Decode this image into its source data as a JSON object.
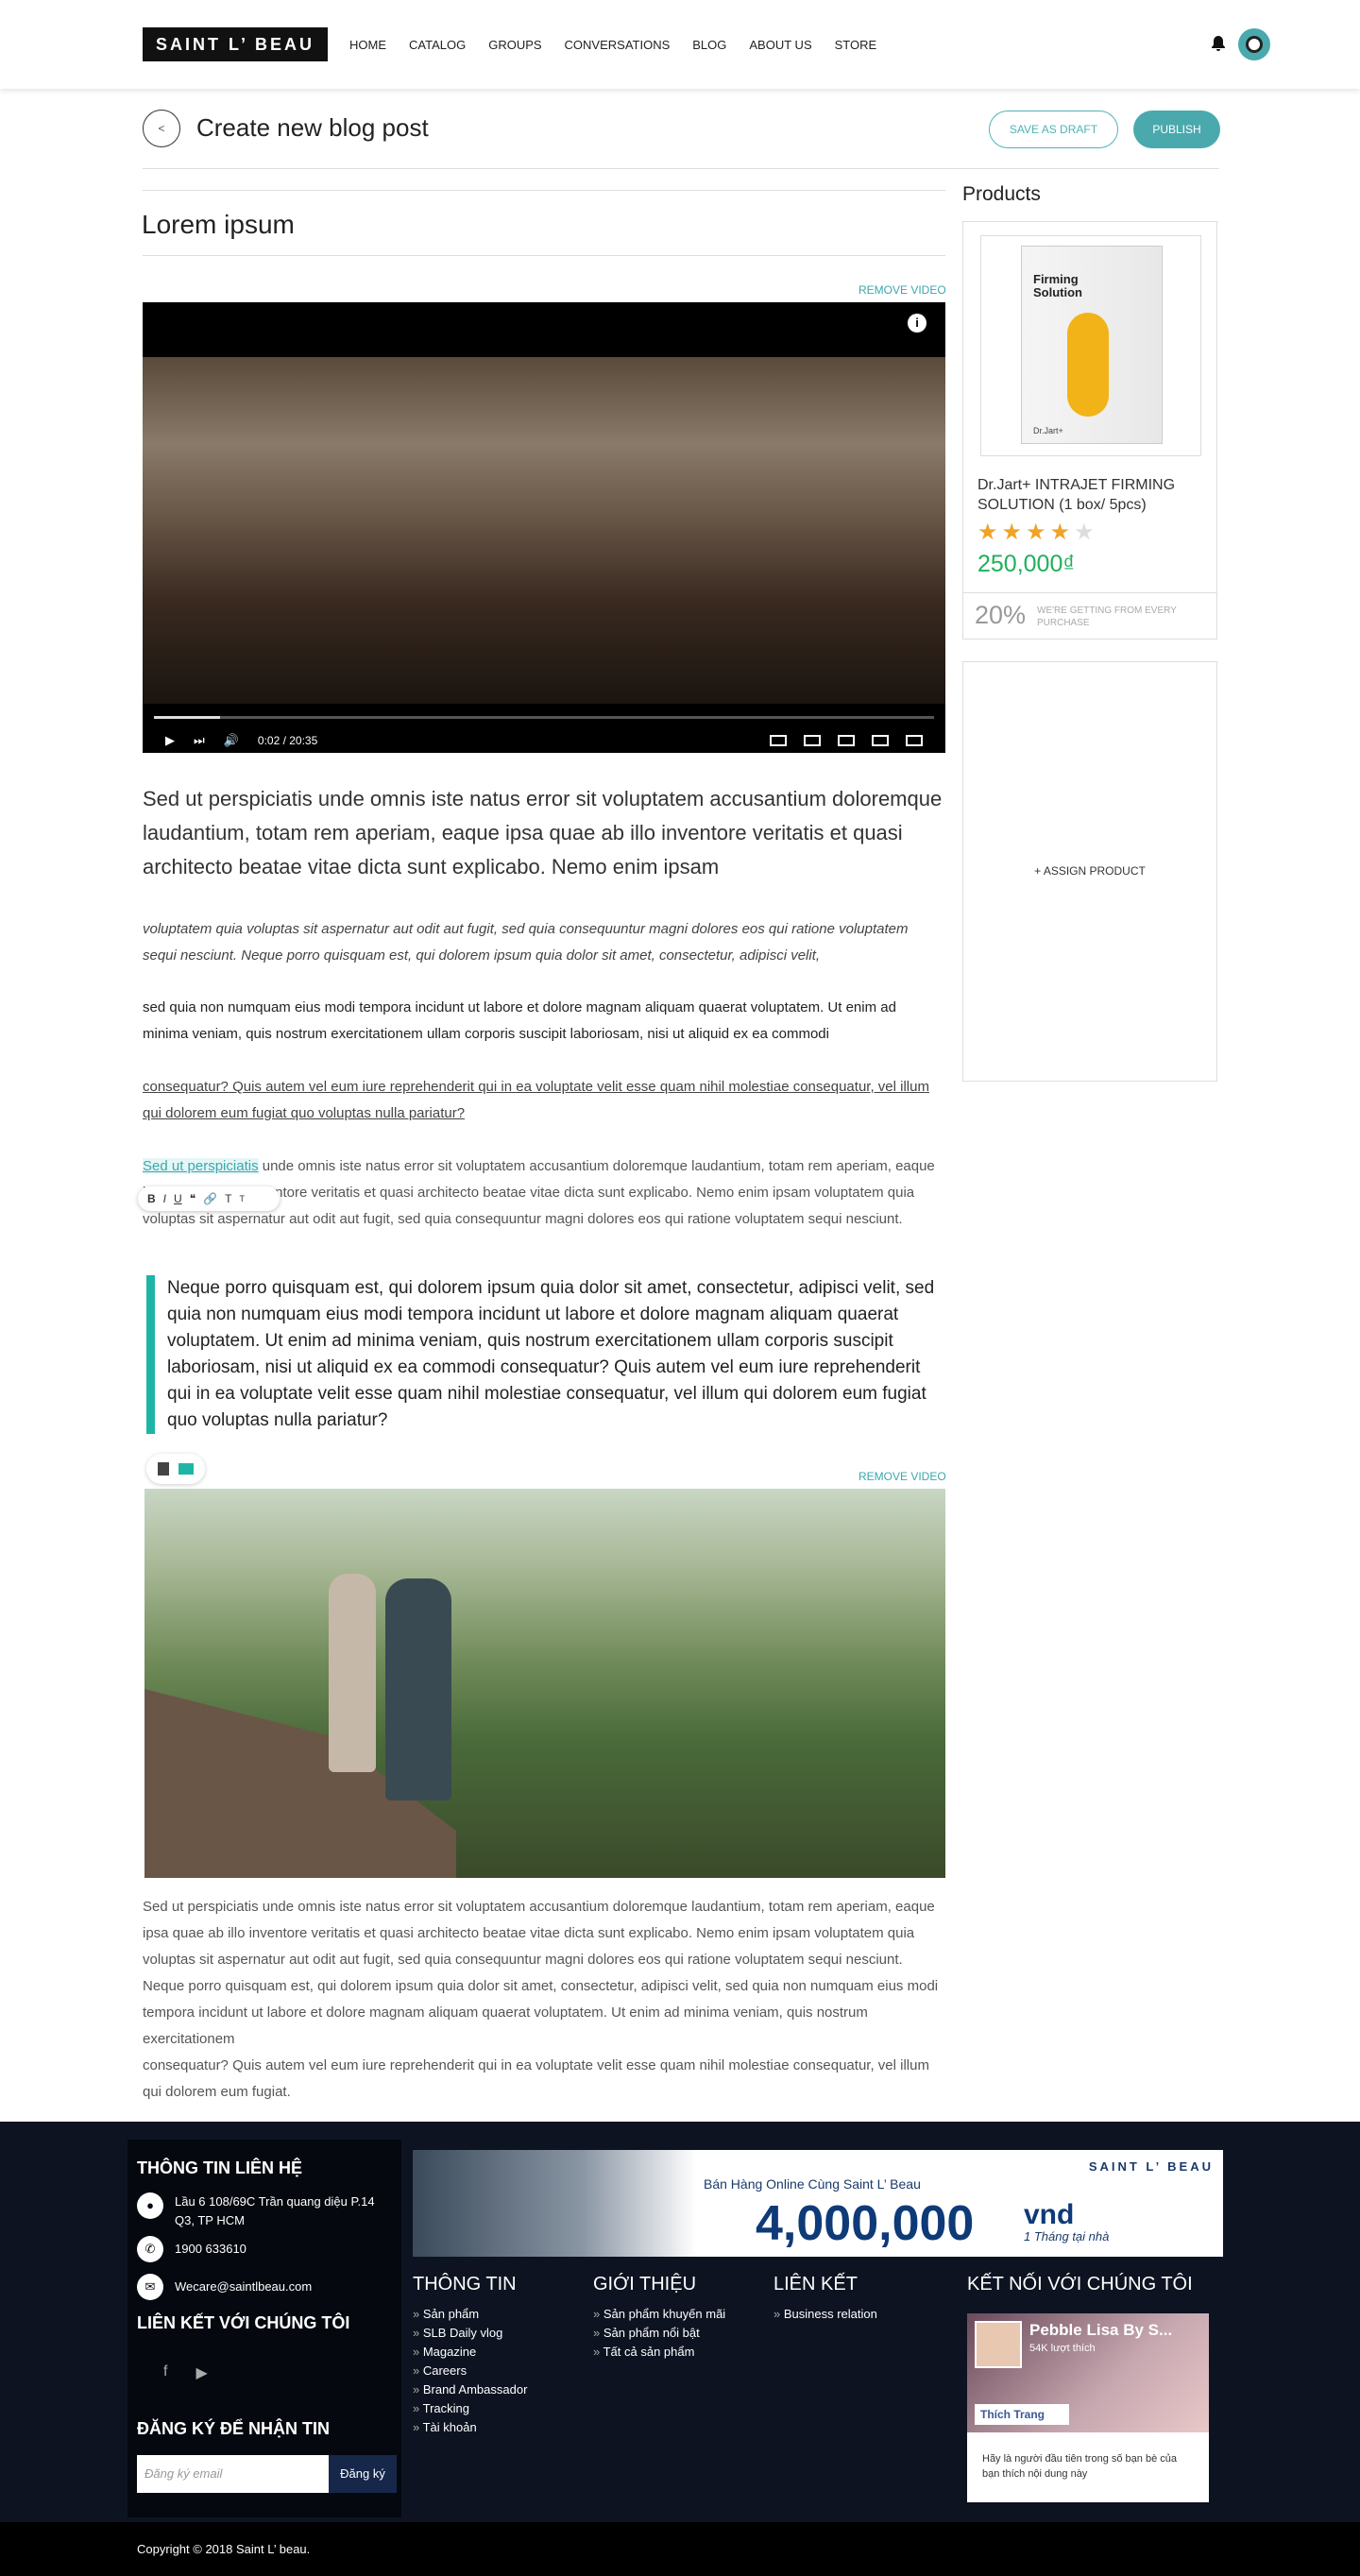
{
  "header": {
    "logo": "SAINT L’ BEAU",
    "nav": [
      "HOME",
      "CATALOG",
      "GROUPS",
      "CONVERSATIONS",
      "BLOG",
      "ABOUT US",
      "STORE"
    ]
  },
  "editor": {
    "back_label": "<",
    "page_title": "Create new blog post",
    "save_draft": "SAVE AS DRAFT",
    "publish": "PUBLISH",
    "post_title": "Lorem ipsum",
    "remove_video": "REMOVE VIDEO",
    "video_time": "0:02 / 20:35",
    "lead": "Sed ut perspiciatis unde omnis iste natus error sit voluptatem accusantium doloremque laudantium, totam rem aperiam, eaque ipsa quae ab illo inventore veritatis et quasi architecto beatae vitae dicta sunt explicabo. Nemo enim ipsam",
    "para_italic": "voluptatem quia voluptas sit aspernatur aut odit aut fugit, sed quia consequuntur magni dolores eos qui ratione voluptatem sequi nesciunt. Neque porro quisquam est, qui dolorem ipsum quia dolor sit amet, consectetur, adipisci velit,",
    "para_normal": "sed quia non numquam eius modi tempora incidunt ut labore et dolore magnam aliquam quaerat voluptatem. Ut enim ad minima veniam, quis nostrum exercitationem ullam corporis suscipit laboriosam, nisi ut aliquid ex ea commodi",
    "para_underline": "consequatur? Quis autem vel eum iure reprehenderit qui in ea voluptate velit esse quam nihil molestiae consequatur, vel illum qui dolorem eum fugiat quo voluptas nulla pariatur?",
    "para_link_selected": "Sed ut perspiciatis",
    "para_link_rest": " unde omnis iste natus error sit voluptatem accusantium doloremque laudantium, totam rem aperiam, eaque ipsa quae ab illo inventore veritatis et quasi architecto beatae vitae dicta sunt explicabo. Nemo enim ipsam voluptatem quia voluptas sit aspernatur aut odit aut fugit, sed quia consequuntur magni dolores eos qui ratione voluptatem sequi nesciunt.",
    "toolbar": {
      "bold": "B",
      "italic": "I",
      "underline": "U",
      "quote": "❝",
      "link": "🔗",
      "text_large": "T",
      "text_small": "T"
    },
    "quote": "Neque porro quisquam est, qui dolorem ipsum quia dolor sit amet, consectetur, adipisci velit, sed quia non numquam eius modi tempora incidunt ut labore et dolore magnam aliquam quaerat voluptatem. Ut enim ad minima veniam, quis nostrum exercitationem ullam corporis suscipit laboriosam, nisi ut aliquid ex ea commodi consequatur? Quis autem vel eum iure reprehenderit qui in ea voluptate velit esse quam nihil molestiae consequatur, vel illum qui dolorem eum fugiat quo voluptas nulla pariatur?",
    "remove_video_2": "REMOVE VIDEO",
    "para_end": "Sed ut perspiciatis unde omnis iste natus error sit voluptatem accusantium doloremque laudantium, totam rem aperiam, eaque ipsa quae ab illo inventore veritatis et quasi architecto beatae vitae dicta sunt explicabo. Nemo enim ipsam voluptatem quia voluptas sit aspernatur aut odit aut fugit, sed quia consequuntur magni dolores eos qui ratione voluptatem sequi nesciunt. Neque porro quisquam est, qui dolorem ipsum quia dolor sit amet, consectetur, adipisci velit, sed quia non numquam eius modi tempora incidunt ut labore et dolore magnam aliquam quaerat voluptatem. Ut enim ad minima veniam, quis nostrum exercitationem",
    "para_end_2": "consequatur? Quis autem vel eum iure reprehenderit qui in ea voluptate velit esse quam nihil molestiae consequatur, vel illum qui dolorem eum fugiat."
  },
  "products": {
    "heading": "Products",
    "box_title": "Firming Solution",
    "box_brand": "Dr.Jart+",
    "name": "Dr.Jart+ INTRAJET FIRMING SOLUTION (1 box/ 5pcs)",
    "rating": 4,
    "price": "250,000₫",
    "discount": "20%",
    "discount_text": "WE'RE GETTING FROM EVERY PURCHASE",
    "assign": "+ ASSIGN PRODUCT"
  },
  "footer": {
    "contact_title": "THÔNG TIN LIÊN HỆ",
    "address": "Lầu 6 108/69C Trần quang diệu P.14 Q3, TP HCM",
    "phone": "1900 633610",
    "email": "Wecare@saintlbeau.com",
    "social_title": "LIÊN KẾT VỚI CHÚNG TÔI",
    "subscribe_title": "ĐĂNG KÝ ĐỂ NHẬN TIN",
    "email_placeholder": "Đăng ký email",
    "subscribe_button": "Đăng ký",
    "banner": {
      "brand": "SAINT L’ BEAU",
      "sub": "Bán Hàng Online Cùng Saint L’ Beau",
      "amount": "4,000,000",
      "unit": "vnd",
      "period": "1 Tháng tại nhà"
    },
    "col1": {
      "title": "THÔNG TIN",
      "items": [
        "Sản phẩm",
        "SLB Daily vlog",
        "Magazine",
        "Careers",
        "Brand Ambassador",
        "Tracking",
        "Tài khoản"
      ]
    },
    "col2": {
      "title": "GIỚI THIỆU",
      "items": [
        "Sản phẩm khuyến mãi",
        "Sản phẩm nổi bật",
        "Tất cả sản phẩm"
      ]
    },
    "col3": {
      "title": "LIÊN KẾT",
      "items": [
        "Business relation"
      ]
    },
    "col4": {
      "title": "KẾT NỐI VỚI CHÚNG TÔI"
    },
    "fb": {
      "name": "Pebble Lisa By S...",
      "likes": "54K lượt thích",
      "like_btn": "Thích Trang",
      "text": "Hãy là người đầu tiên trong số bạn bè của bạn thích nội dung này"
    },
    "copyright": "Copyright © 2018 Saint L’ beau."
  }
}
